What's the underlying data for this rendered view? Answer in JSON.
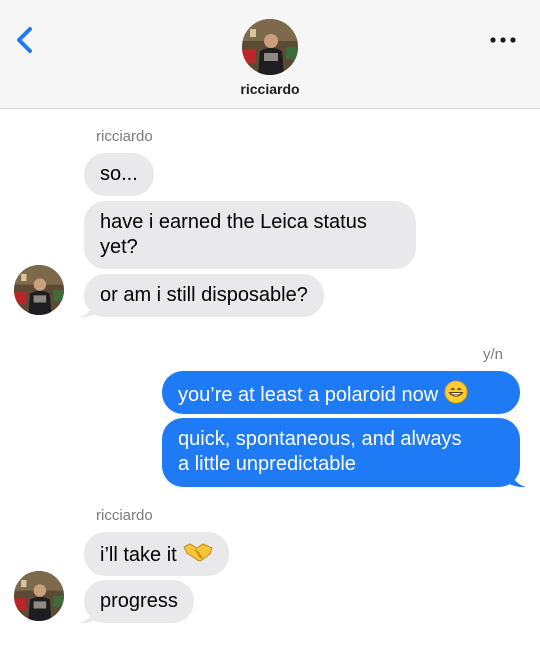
{
  "header": {
    "contact_name": "ricciardo",
    "back_icon": "chevron-left-icon",
    "more_icon": "ellipsis-icon",
    "accent_color": "#1f7af6"
  },
  "thread": {
    "group1": {
      "sender": "ricciardo",
      "messages": [
        "so...",
        "have i earned the Leica status",
        "yet?",
        "or am i still disposable?"
      ]
    },
    "group2": {
      "sender": "y/n",
      "messages": [
        "you’re at least a polaroid now",
        "quick, spontaneous, and always",
        "a little unpredictable"
      ],
      "emoji": "grinning-face-icon"
    },
    "group3": {
      "sender": "ricciardo",
      "messages": [
        "i’ll take it",
        "progress"
      ],
      "emoji": "handshake-icon"
    }
  },
  "colors": {
    "incoming_bubble": "#e9e9eb",
    "outgoing_bubble": "#1f7af6"
  }
}
